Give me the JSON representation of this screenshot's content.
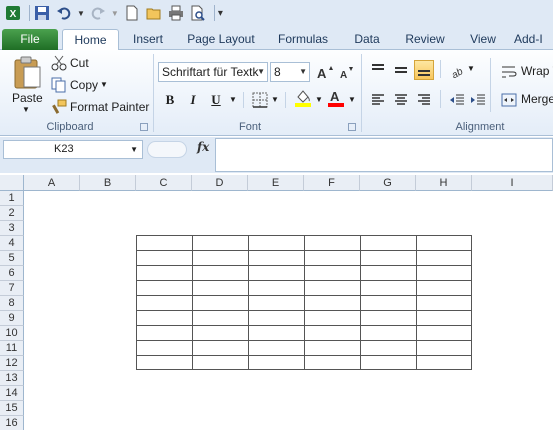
{
  "qat": {
    "icons": [
      "excel-logo-icon",
      "save-icon",
      "undo-icon",
      "redo-icon",
      "new-icon",
      "open-icon",
      "print-icon",
      "print-preview-icon",
      "customize-icon"
    ]
  },
  "tabs": [
    "File",
    "Home",
    "Insert",
    "Page Layout",
    "Formulas",
    "Data",
    "Review",
    "View",
    "Add-I"
  ],
  "ribbon": {
    "clipboard": {
      "paste": "Paste",
      "cut": "Cut",
      "copy": "Copy",
      "format_painter": "Format Painter",
      "label": "Clipboard"
    },
    "font": {
      "font_name": "Schriftart für Textk",
      "font_size": "8",
      "bold": "B",
      "italic": "I",
      "underline": "U",
      "label": "Font",
      "fill_color": "#ffff00",
      "font_color": "#ff0000"
    },
    "alignment": {
      "wrap": "Wrap T",
      "merge": "Merge",
      "label": "Alignment"
    }
  },
  "formula_bar": {
    "name_box": "K23",
    "fx": "fx",
    "value": ""
  },
  "columns": [
    "A",
    "B",
    "C",
    "D",
    "E",
    "F",
    "G",
    "H",
    "I"
  ],
  "rows": [
    "1",
    "2",
    "3",
    "4",
    "5",
    "6",
    "7",
    "8",
    "9",
    "10",
    "11",
    "12",
    "13",
    "14",
    "15",
    "16"
  ],
  "bordered_range": {
    "columns": [
      "C",
      "D",
      "E",
      "F",
      "G",
      "H"
    ],
    "rows": [
      "4",
      "5",
      "6",
      "7",
      "8",
      "9",
      "10",
      "11",
      "12"
    ]
  }
}
